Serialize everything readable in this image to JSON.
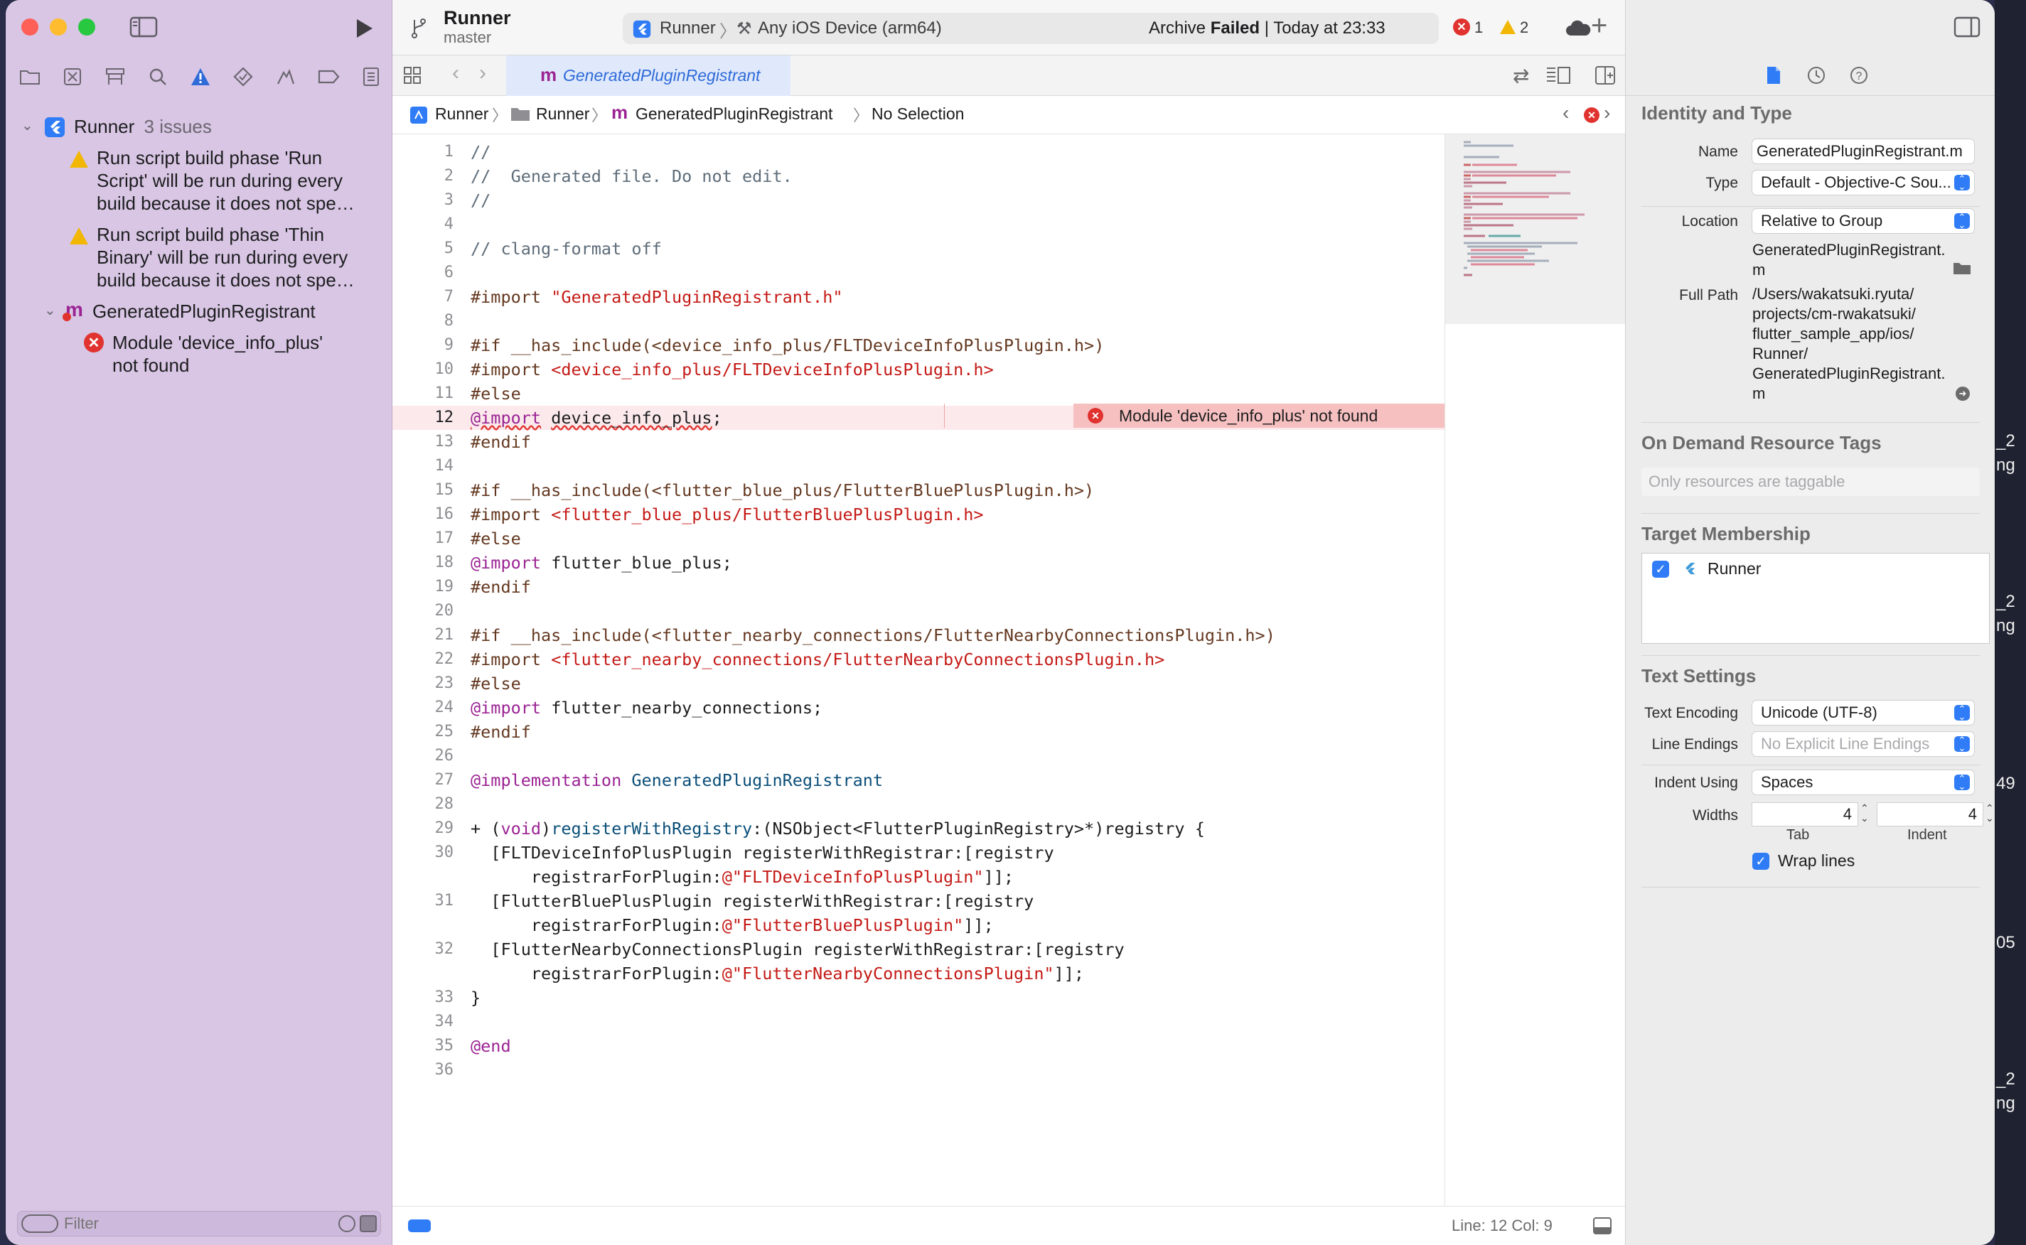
{
  "window": {
    "scheme": "Runner",
    "branch": "master",
    "breadcrumb_scheme": "Runner",
    "destination": "Any iOS Device (arm64)",
    "activity_prefix": "Archive",
    "activity_status": "Failed",
    "activity_time": "| Today at 23:33",
    "error_count": "1",
    "warning_count": "2"
  },
  "navigator": {
    "project_name": "Runner",
    "project_issues": "3 issues",
    "issues": [
      {
        "text": "Run script build phase 'Run Script' will be run during every build because it does not spe…",
        "lines": [
          "Run script build phase 'Run",
          "Script' will be run during every",
          "build because it does not spe…"
        ]
      },
      {
        "text": "Run script build phase 'Thin Binary' will be run during every build because it does not spe…",
        "lines": [
          "Run script build phase 'Thin",
          "Binary' will be run during every",
          "build because it does not spe…"
        ]
      }
    ],
    "file_group": "GeneratedPluginRegistrant",
    "file_issue_lines": [
      "Module 'device_info_plus'",
      "not found"
    ],
    "filter_placeholder": "Filter"
  },
  "tab": {
    "icon": "m",
    "label": "GeneratedPluginRegistrant"
  },
  "jumpbar": [
    "Runner",
    "Runner",
    "GeneratedPluginRegistrant",
    "No Selection"
  ],
  "editor": {
    "error_message": "Module 'device_info_plus' not found",
    "lines": [
      {
        "n": "1",
        "h": "<span class=\"cm\">//</span>"
      },
      {
        "n": "2",
        "h": "<span class=\"cm\">//  Generated file. Do not edit.</span>"
      },
      {
        "n": "3",
        "h": "<span class=\"cm\">//</span>"
      },
      {
        "n": "4",
        "h": ""
      },
      {
        "n": "5",
        "h": "<span class=\"cm\">// clang-format off</span>"
      },
      {
        "n": "6",
        "h": ""
      },
      {
        "n": "7",
        "h": "<span class=\"pp\">#import</span> <span class=\"str\">\"GeneratedPluginRegistrant.h\"</span>"
      },
      {
        "n": "8",
        "h": ""
      },
      {
        "n": "9",
        "h": "<span class=\"pp\">#if __has_include(&lt;device_info_plus/FLTDeviceInfoPlusPlugin.h&gt;)</span>"
      },
      {
        "n": "10",
        "h": "<span class=\"pp\">#import</span> <span class=\"str\">&lt;device_info_plus/FLTDeviceInfoPlusPlugin.h&gt;</span>"
      },
      {
        "n": "11",
        "h": "<span class=\"pp\">#else</span>"
      },
      {
        "n": "12",
        "h": "<span class=\"kw\" style=\"text-decoration:underline wavy #e0332f\">@import</span> <span style=\"text-decoration:underline wavy #e0332f\">device_info_plus</span>;"
      },
      {
        "n": "13",
        "h": "<span class=\"pp\">#endif</span>"
      },
      {
        "n": "14",
        "h": ""
      },
      {
        "n": "15",
        "h": "<span class=\"pp\">#if __has_include(&lt;flutter_blue_plus/FlutterBluePlusPlugin.h&gt;)</span>"
      },
      {
        "n": "16",
        "h": "<span class=\"pp\">#import</span> <span class=\"str\">&lt;flutter_blue_plus/FlutterBluePlusPlugin.h&gt;</span>"
      },
      {
        "n": "17",
        "h": "<span class=\"pp\">#else</span>"
      },
      {
        "n": "18",
        "h": "<span class=\"kw\">@import</span> flutter_blue_plus;"
      },
      {
        "n": "19",
        "h": "<span class=\"pp\">#endif</span>"
      },
      {
        "n": "20",
        "h": ""
      },
      {
        "n": "21",
        "h": "<span class=\"pp\">#if __has_include(&lt;flutter_nearby_connections/FlutterNearbyConnectionsPlugin.h&gt;)</span>"
      },
      {
        "n": "22",
        "h": "<span class=\"pp\">#import</span> <span class=\"str\">&lt;flutter_nearby_connections/FlutterNearbyConnectionsPlugin.h&gt;</span>"
      },
      {
        "n": "23",
        "h": "<span class=\"pp\">#else</span>"
      },
      {
        "n": "24",
        "h": "<span class=\"kw\">@import</span> flutter_nearby_connections;"
      },
      {
        "n": "25",
        "h": "<span class=\"pp\">#endif</span>"
      },
      {
        "n": "26",
        "h": ""
      },
      {
        "n": "27",
        "h": "<span class=\"kw\">@implementation</span> <span class=\"ty\">GeneratedPluginRegistrant</span>"
      },
      {
        "n": "28",
        "h": ""
      },
      {
        "n": "29",
        "h": "+ (<span class=\"kw\">void</span>)<span class=\"ty\">registerWithRegistry</span>:(NSObject&lt;FlutterPluginRegistry&gt;*)registry {"
      },
      {
        "n": "30",
        "h": "  [FLTDeviceInfoPlusPlugin registerWithRegistrar:[registry"
      },
      {
        "n": "",
        "h": "      registrarForPlugin:<span class=\"str\">@\"FLTDeviceInfoPlusPlugin\"</span>]];"
      },
      {
        "n": "31",
        "h": "  [FlutterBluePlusPlugin registerWithRegistrar:[registry"
      },
      {
        "n": "",
        "h": "      registrarForPlugin:<span class=\"str\">@\"FlutterBluePlusPlugin\"</span>]];"
      },
      {
        "n": "32",
        "h": "  [FlutterNearbyConnectionsPlugin registerWithRegistrar:[registry"
      },
      {
        "n": "",
        "h": "      registrarForPlugin:<span class=\"str\">@\"FlutterNearbyConnectionsPlugin\"</span>]];"
      },
      {
        "n": "33",
        "h": "}"
      },
      {
        "n": "34",
        "h": ""
      },
      {
        "n": "35",
        "h": "<span class=\"kw\">@end</span>"
      },
      {
        "n": "36",
        "h": ""
      }
    ]
  },
  "status": {
    "line_col": "Line: 12  Col: 9"
  },
  "inspector": {
    "identity_title": "Identity and Type",
    "name_label": "Name",
    "name_value": "GeneratedPluginRegistrant.m",
    "type_label": "Type",
    "type_value": "Default - Objective-C Sou...",
    "location_label": "Location",
    "location_value": "Relative to Group",
    "location_file_lines": [
      "GeneratedPluginRegistrant.",
      "m"
    ],
    "fullpath_label": "Full Path",
    "fullpath_lines": [
      "/Users/wakatsuki.ryuta/",
      "projects/cm-rwakatsuki/",
      "flutter_sample_app/ios/",
      "Runner/",
      "GeneratedPluginRegistrant.",
      "m"
    ],
    "odr_title": "On Demand Resource Tags",
    "odr_placeholder": "Only resources are taggable",
    "target_title": "Target Membership",
    "target_name": "Runner",
    "text_title": "Text Settings",
    "encoding_label": "Text Encoding",
    "encoding_value": "Unicode (UTF-8)",
    "endings_label": "Line Endings",
    "endings_value": "No Explicit Line Endings",
    "indent_label": "Indent Using",
    "indent_value": "Spaces",
    "widths_label": "Widths",
    "tab_value": "4",
    "indent_width_value": "4",
    "tab_caption": "Tab",
    "indent_caption": "Indent",
    "wrap_label": "Wrap lines"
  },
  "wallpaper_fragments": [
    "_2",
    "ng",
    "_2",
    "ng",
    "49",
    "05",
    "_2",
    "ng"
  ]
}
